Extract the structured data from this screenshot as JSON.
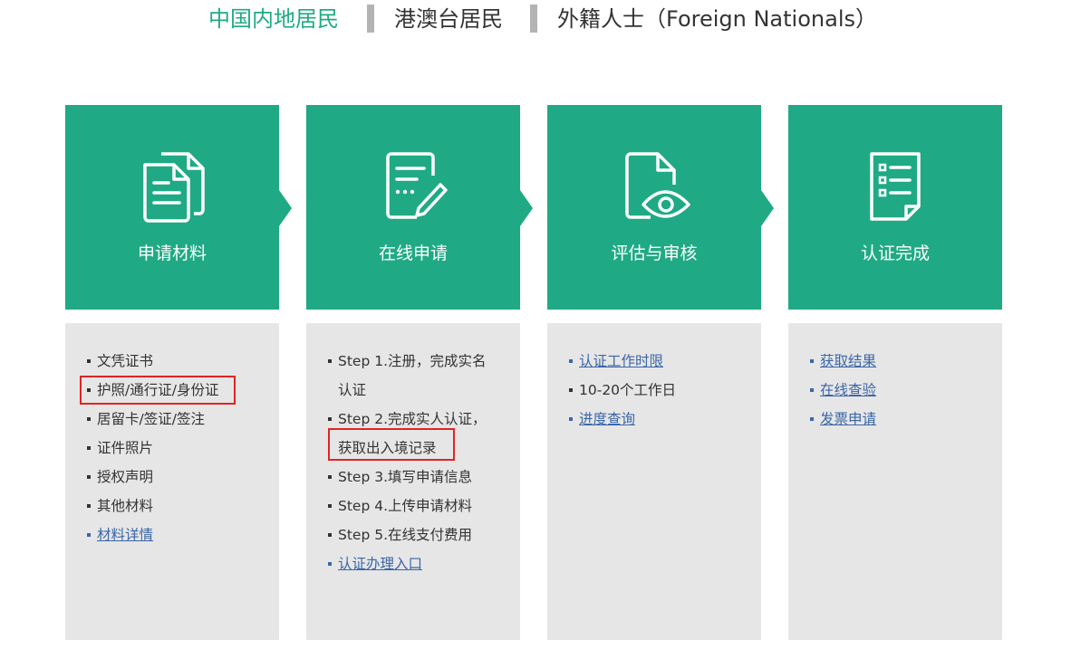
{
  "tabs": [
    {
      "label": "中国内地居民",
      "active": true
    },
    {
      "label": "港澳台居民",
      "active": false
    },
    {
      "label": "外籍人士（Foreign Nationals）",
      "active": false
    }
  ],
  "colors": {
    "accent": "#1faa85",
    "panel": "#e6e6e6",
    "link": "#3b66a8",
    "highlight": "#e02424"
  },
  "steps": [
    {
      "title": "申请材料",
      "icon": "documents-icon",
      "items": [
        {
          "text": "文凭证书"
        },
        {
          "text": "护照/通行证/身份证",
          "highlighted": true
        },
        {
          "text": "居留卡/签证/签注"
        },
        {
          "text": "证件照片"
        },
        {
          "text": "授权声明"
        },
        {
          "text": "其他材料"
        },
        {
          "text": "材料详情",
          "link": true
        }
      ]
    },
    {
      "title": "在线申请",
      "icon": "form-edit-icon",
      "items": [
        {
          "text": "Step 1.注册，完成实名"
        },
        {
          "text": "认证"
        },
        {
          "text": "Step 2.完成实人认证，"
        },
        {
          "text": "获取出入境记录",
          "highlighted": true
        },
        {
          "text": "Step 3.填写申请信息"
        },
        {
          "text": "Step 4.上传申请材料"
        },
        {
          "text": "Step 5.在线支付费用"
        },
        {
          "text": "认证办理入口",
          "link": true
        }
      ]
    },
    {
      "title": "评估与审核",
      "icon": "document-eye-icon",
      "items": [
        {
          "text": "认证工作时限",
          "link": true
        },
        {
          "text": "10-20个工作日"
        },
        {
          "text": "进度查询",
          "link": true
        }
      ]
    },
    {
      "title": "认证完成",
      "icon": "checklist-icon",
      "items": [
        {
          "text": "获取结果",
          "link": true
        },
        {
          "text": "在线查验",
          "link": true
        },
        {
          "text": "发票申请",
          "link": true
        }
      ]
    }
  ]
}
